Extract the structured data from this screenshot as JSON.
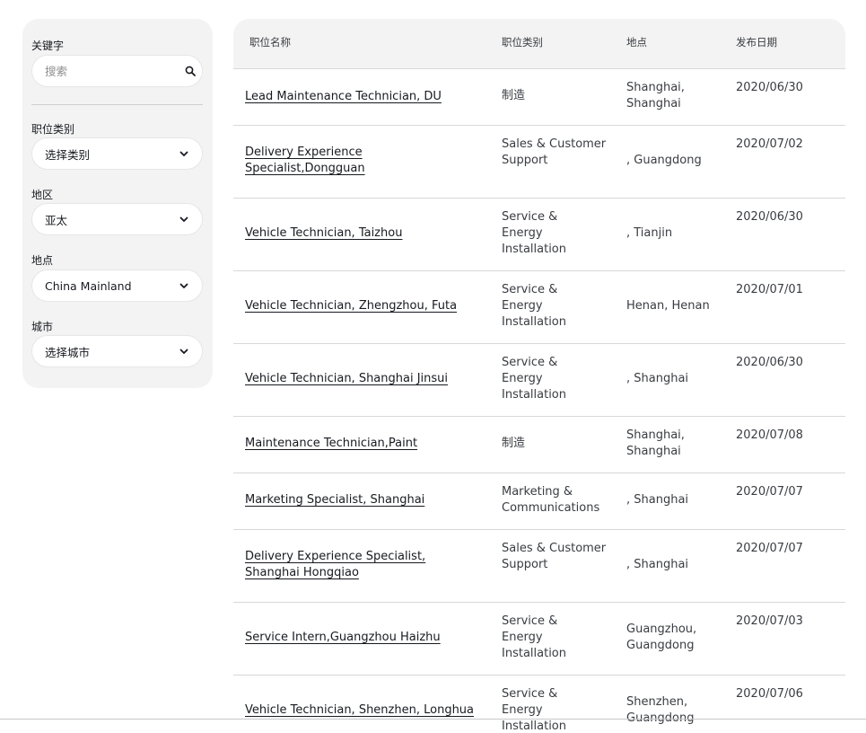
{
  "filters": {
    "keyword": {
      "label": "关键字",
      "placeholder": "搜索",
      "icon": "search-icon"
    },
    "category": {
      "label": "职位类别",
      "value": "选择类别"
    },
    "region": {
      "label": "地区",
      "value": "亚太"
    },
    "location": {
      "label": "地点",
      "value": "China Mainland"
    },
    "city": {
      "label": "城市",
      "value": "选择城市"
    }
  },
  "table": {
    "headers": {
      "title": "职位名称",
      "category": "职位类别",
      "location": "地点",
      "date": "发布日期"
    },
    "rows": [
      {
        "title": "Lead Maintenance Technician, DU",
        "category": "制造",
        "location": "Shanghai, Shanghai",
        "date": "2020/06/30"
      },
      {
        "title": "Delivery Experience Specialist,Dongguan",
        "category": "Sales & Customer Support",
        "location": ", Guangdong",
        "date": "2020/07/02"
      },
      {
        "title": "Vehicle Technician, Taizhou",
        "category": "Service & Energy Installation",
        "location": ", Tianjin",
        "date": "2020/06/30"
      },
      {
        "title": "Vehicle Technician, Zhengzhou, Futa",
        "category": "Service & Energy Installation",
        "location": "Henan, Henan",
        "date": "2020/07/01"
      },
      {
        "title": "Vehicle Technician, Shanghai Jinsui",
        "category": "Service & Energy Installation",
        "location": ", Shanghai",
        "date": "2020/06/30"
      },
      {
        "title": "Maintenance Technician,Paint",
        "category": "制造",
        "location": "Shanghai, Shanghai",
        "date": "2020/07/08"
      },
      {
        "title": "Marketing Specialist, Shanghai",
        "category": "Marketing & Communications",
        "location": ", Shanghai",
        "date": "2020/07/07"
      },
      {
        "title": "Delivery Experience Specialist, Shanghai Hongqiao",
        "category": "Sales & Customer Support",
        "location": ", Shanghai",
        "date": "2020/07/07"
      },
      {
        "title": "Service Intern,Guangzhou Haizhu",
        "category": "Service & Energy Installation",
        "location": "Guangzhou, Guangdong",
        "date": "2020/07/03"
      },
      {
        "title": "Vehicle Technician, Shenzhen, Longhua",
        "category": "Service & Energy Installation",
        "location": "Shenzhen, Guangdong",
        "date": "2020/07/06"
      }
    ]
  }
}
